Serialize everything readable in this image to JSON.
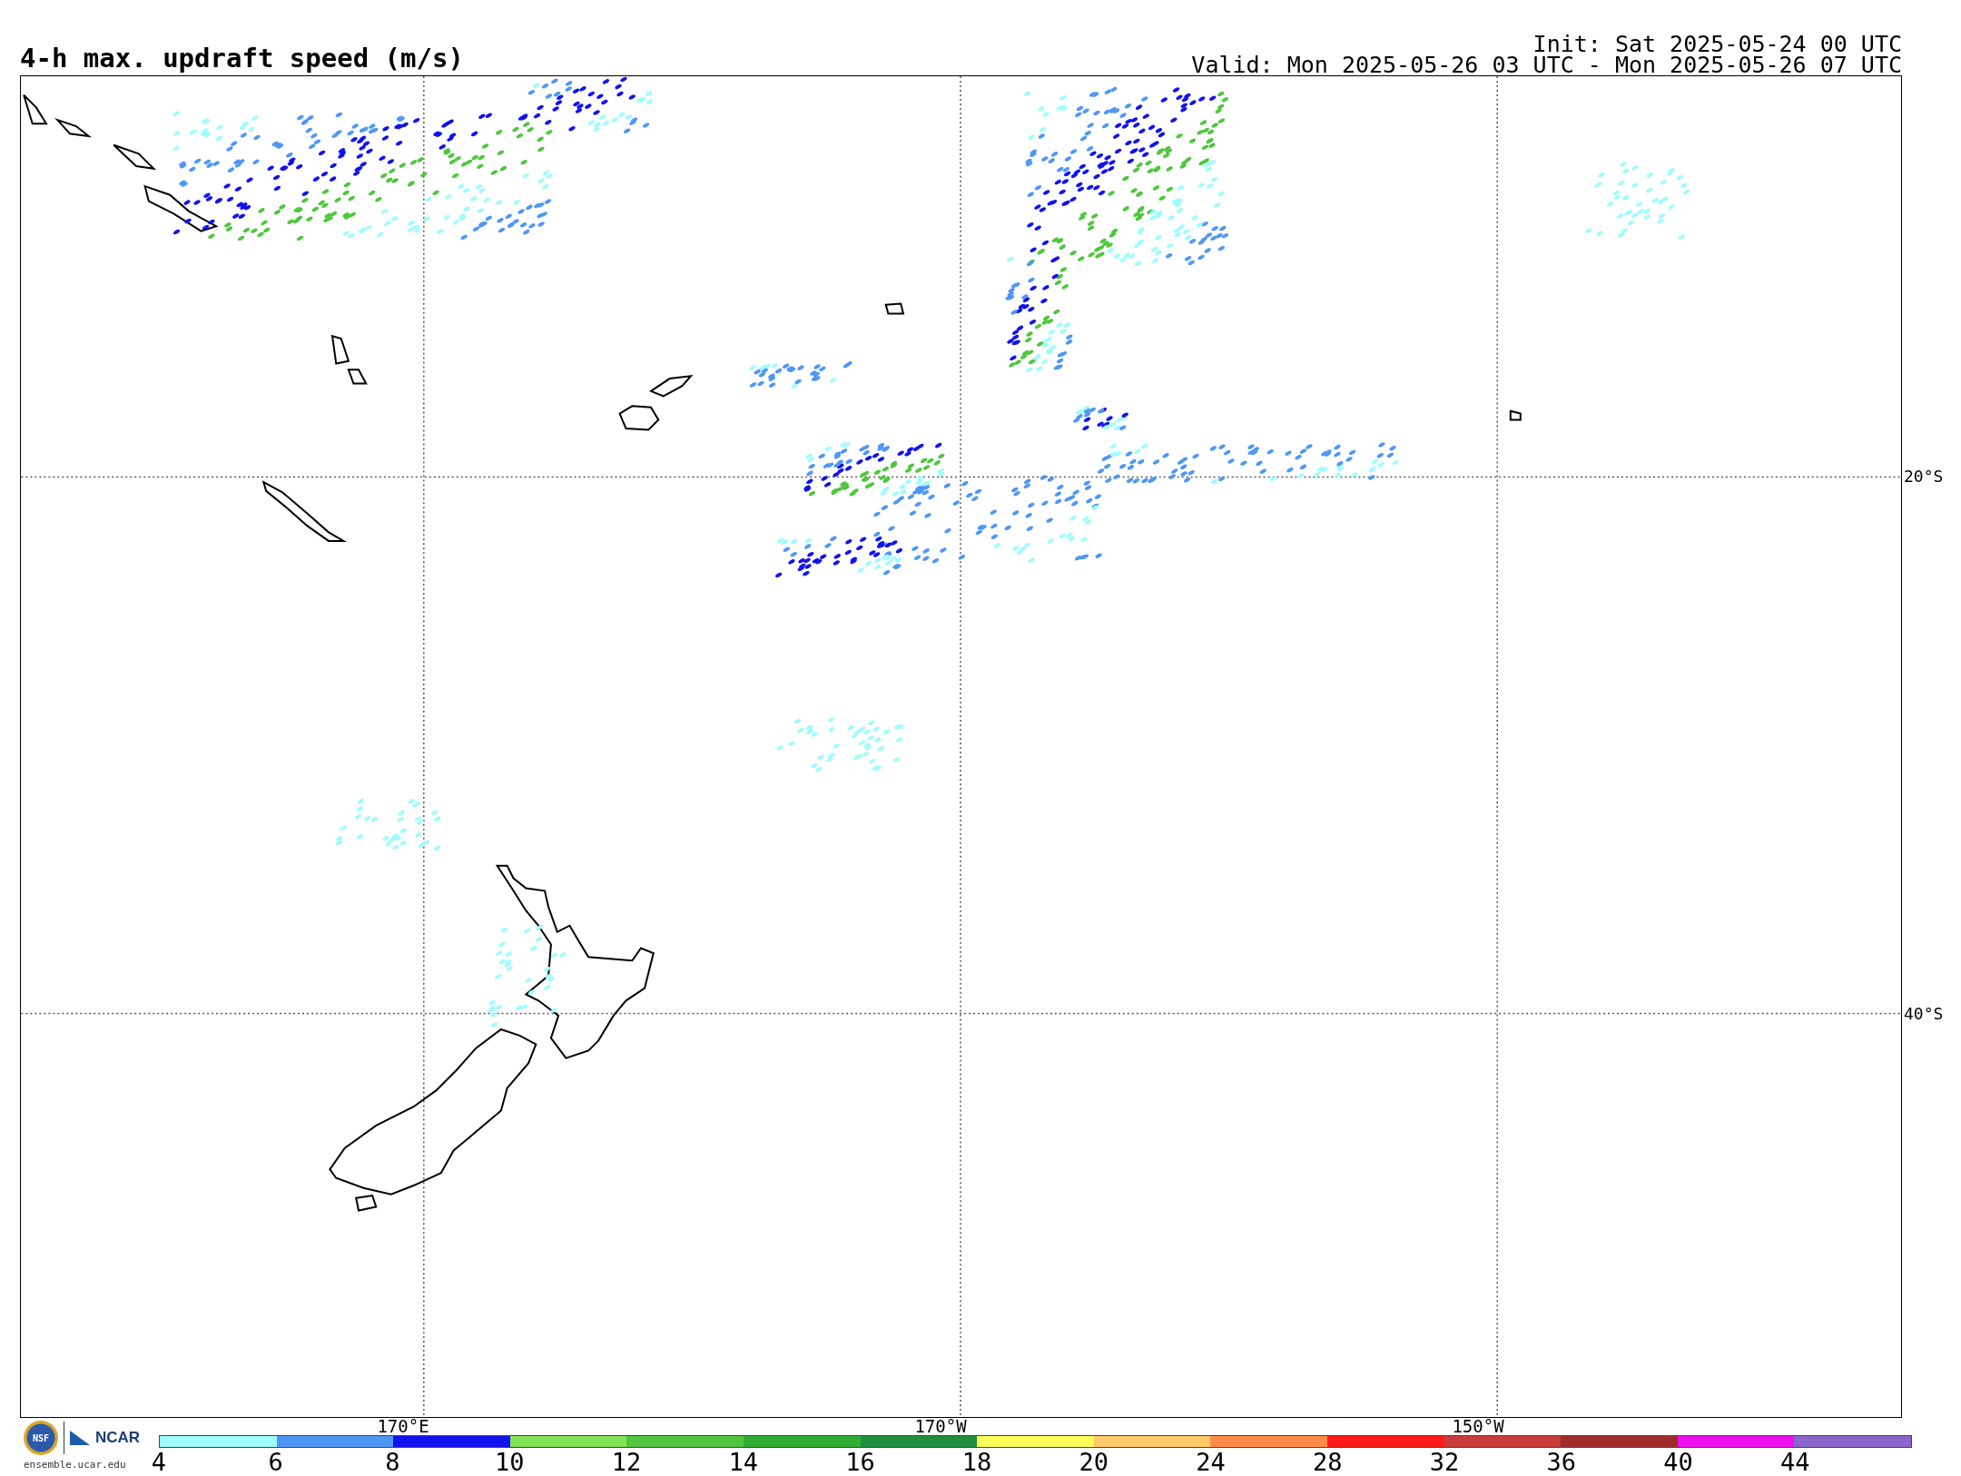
{
  "title": "4-h max. updraft speed (m/s)",
  "init": "Init: Sat 2025-05-24 00 UTC",
  "valid": "Valid: Mon 2025-05-26 03 UTC - Mon 2025-05-26 07 UTC",
  "longitude_labels": [
    "170°E",
    "170°W",
    "150°W"
  ],
  "latitude_labels": [
    "20°S",
    "40°S"
  ],
  "logo": {
    "seal_text": "NSF",
    "name": "NCAR",
    "url": "ensemble.ucar.edu"
  },
  "colorbar": {
    "segments": [
      {
        "color": "#9ffcff"
      },
      {
        "color": "#4f97f5"
      },
      {
        "color": "#1212ee"
      },
      {
        "color": "#82e356"
      },
      {
        "color": "#4fc63e"
      },
      {
        "color": "#2fae33"
      },
      {
        "color": "#1f8f3e"
      },
      {
        "color": "#ffff5a"
      },
      {
        "color": "#ffc965"
      },
      {
        "color": "#ff8a48"
      },
      {
        "color": "#ff1a1a"
      },
      {
        "color": "#c83c3c"
      },
      {
        "color": "#a02b2b"
      },
      {
        "color": "#ee10ee"
      },
      {
        "color": "#8a66cc"
      }
    ],
    "ticks": [
      "4",
      "6",
      "8",
      "10",
      "12",
      "14",
      "16",
      "18",
      "20",
      "24",
      "28",
      "32",
      "36",
      "40",
      "44"
    ]
  }
}
